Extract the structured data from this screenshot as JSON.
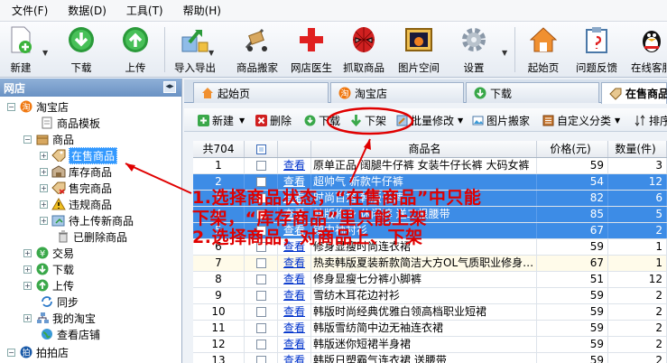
{
  "menu": [
    "文件(F)",
    "数据(D)",
    "工具(T)",
    "帮助(H)"
  ],
  "toolbar": [
    {
      "label": "新建",
      "icon": "new-icon"
    },
    {
      "label": "下载",
      "icon": "download-icon"
    },
    {
      "label": "上传",
      "icon": "upload-icon"
    },
    {
      "label": "导入导出",
      "icon": "import-export-icon"
    },
    {
      "label": "商品搬家",
      "icon": "move-cart-icon"
    },
    {
      "label": "网店医生",
      "icon": "doctor-cross-icon"
    },
    {
      "label": "抓取商品",
      "icon": "spiderman-icon"
    },
    {
      "label": "图片空间",
      "icon": "picture-icon"
    },
    {
      "label": "设置",
      "icon": "gear-icon"
    },
    {
      "label": "起始页",
      "icon": "home-icon"
    },
    {
      "label": "问题反馈",
      "icon": "feedback-icon"
    },
    {
      "label": "在线客服",
      "icon": "qq-penguin-icon"
    }
  ],
  "sidebar": {
    "title": "网店",
    "tree": [
      "淘宝店",
      "商品模板",
      "商品",
      "在售商品",
      "库存商品",
      "售完商品",
      "违规商品",
      "待上传新商品",
      "已删除商品",
      "交易",
      "下载",
      "上传",
      "同步",
      "我的淘宝",
      "查看店铺",
      "拍拍店"
    ]
  },
  "tabs": [
    "起始页",
    "淘宝店",
    "下载",
    "在售商品"
  ],
  "subtoolbar": [
    "新建",
    "删除",
    "下载",
    "下架",
    "批量修改",
    "图片搬家",
    "自定义分类",
    "排序"
  ],
  "grid": {
    "total_label": "共704",
    "col_name": "商品名",
    "col_price": "价格(元)",
    "col_qty": "数量(件)",
    "view_label": "查看",
    "rows": [
      {
        "n": "1",
        "name": "原单正品 阔腿牛仔裤 女装牛仔长裤 大码女裤",
        "price": "59",
        "qty": "3"
      },
      {
        "n": "2",
        "name": "超帅气 新款牛仔裤",
        "price": "54",
        "qty": "12"
      },
      {
        "n": "3",
        "name": "时尚百搭 韩版长裤",
        "price": "82",
        "qty": "6"
      },
      {
        "n": "4",
        "name": "韩版修身 休闲裤 送二根腰带",
        "price": "85",
        "qty": "5"
      },
      {
        "n": "5",
        "name": "镇中袖衬衫",
        "price": "67",
        "qty": "2"
      },
      {
        "n": "6",
        "name": "修身显瘦时尚连衣裙",
        "price": "59",
        "qty": "1"
      },
      {
        "n": "7",
        "name": "热卖韩版夏装新款简洁大方OL气质职业修身…",
        "price": "67",
        "qty": "1"
      },
      {
        "n": "8",
        "name": "修身显瘦七分裤小脚裤",
        "price": "51",
        "qty": "12"
      },
      {
        "n": "9",
        "name": "雪纺木耳花边衬衫",
        "price": "59",
        "qty": "2"
      },
      {
        "n": "10",
        "name": "韩版时尚经典优雅白领高档职业短裙",
        "price": "59",
        "qty": "2"
      },
      {
        "n": "11",
        "name": "韩版雪纺简中边无袖连衣裙",
        "price": "59",
        "qty": "2"
      },
      {
        "n": "12",
        "name": "韩版迷你短裙半身裙",
        "price": "59",
        "qty": "2"
      },
      {
        "n": "13",
        "name": "韩版日塑霸气连衣裙 送腰带",
        "price": "59",
        "qty": "2"
      }
    ]
  },
  "annotation": {
    "line1": "1.选择商品状态，“在售商品”中只能",
    "line2": "下架，“库存商品”里只能上架",
    "line3": "2.选择商品，对商品上、下架"
  },
  "colors": {
    "accent": "#3399ff",
    "annotation": "#e00000",
    "selected_row": "#3d8ce6"
  }
}
